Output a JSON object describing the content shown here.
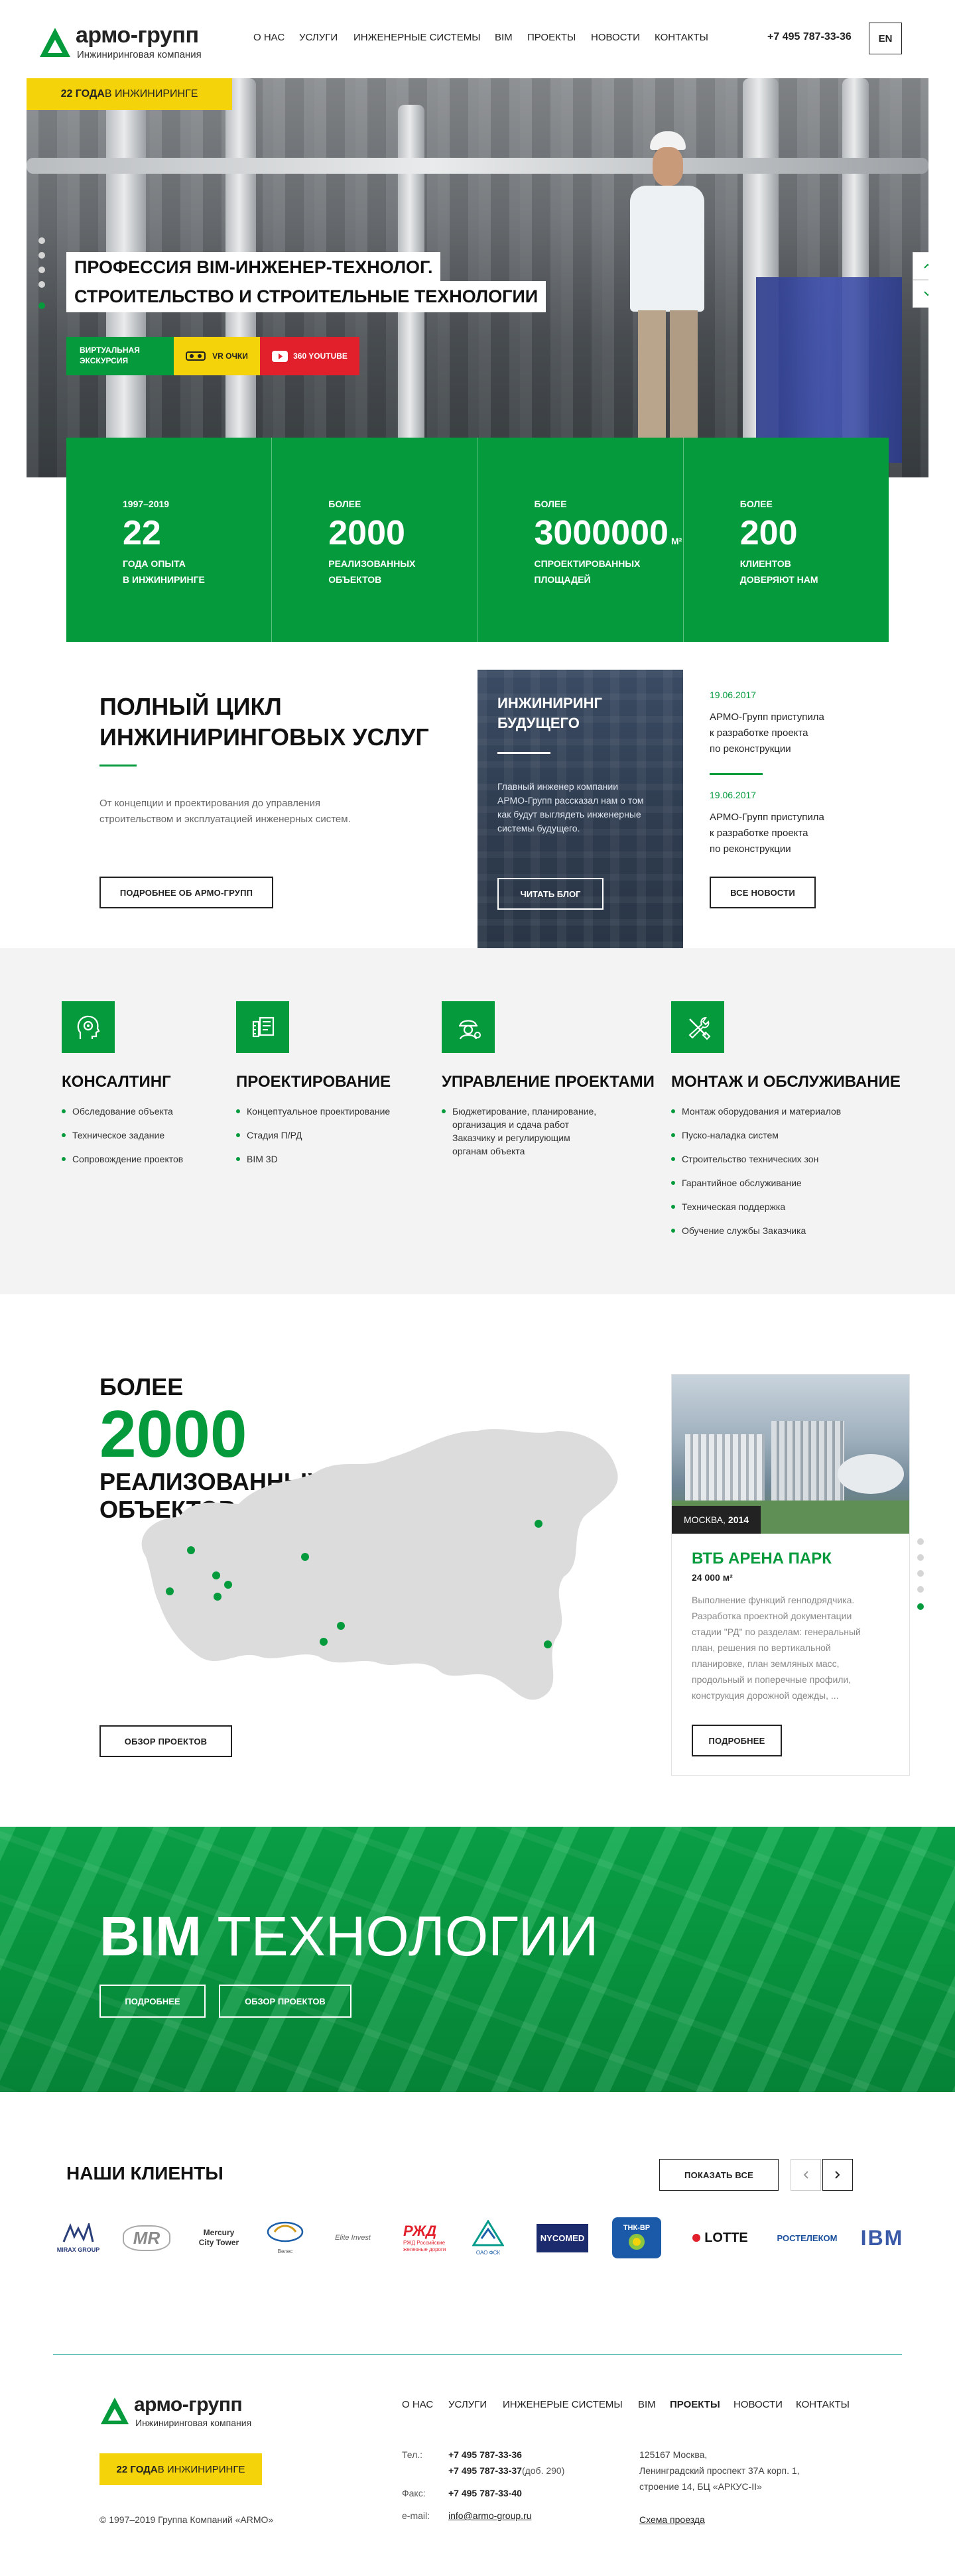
{
  "header": {
    "logo_name": "армо-групп",
    "logo_sub": "Инжиниринговая компания",
    "nav": [
      "О НАС",
      "УСЛУГИ",
      "ИНЖЕНЕРНЫЕ СИСТЕМЫ",
      "BIM",
      "ПРОЕКТЫ",
      "НОВОСТИ",
      "КОНТАКТЫ"
    ],
    "phone": "+7 495 787-33-36",
    "lang": "EN"
  },
  "hero": {
    "badge_bold": "22 ГОДА",
    "badge_rest": " В ИНЖИНИРИНГЕ",
    "title_line1": "ПРОФЕССИЯ BIM-ИНЖЕНЕР-ТЕХНОЛОГ.",
    "title_line2": "СТРОИТЕЛЬСТВО И СТРОИТЕЛЬНЫЕ ТЕХНОЛОГИИ",
    "btn_tour": "ВИРТУАЛЬНАЯ ЭКСКУРСИЯ",
    "btn_vr": "VR ОЧКИ",
    "btn_youtube": "360 YOUTUBE"
  },
  "stats": [
    {
      "label": "1997–2019",
      "value": "22",
      "unit": "",
      "caption1": "ГОДА ОПЫТА",
      "caption2": "В ИНЖИНИРИНГЕ"
    },
    {
      "label": "БОЛЕЕ",
      "value": "2000",
      "unit": "",
      "caption1": "РЕАЛИЗОВАННЫХ",
      "caption2": "ОБЪЕКТОВ"
    },
    {
      "label": "БОЛЕЕ",
      "value": "3000000",
      "unit": "М²",
      "caption1": "СПРОЕКТИРОВАННЫХ",
      "caption2": "ПЛОЩАДЕЙ"
    },
    {
      "label": "БОЛЕЕ",
      "value": "200",
      "unit": "",
      "caption1": "КЛИЕНТОВ",
      "caption2": "ДОВЕРЯЮТ НАМ"
    }
  ],
  "about": {
    "title_line1": "ПОЛНЫЙ ЦИКЛ",
    "title_line2": "ИНЖИНИРИНГОВЫХ УСЛУГ",
    "text_line1": "От концепции и проектирования до управления",
    "text_line2": "строительством и эксплуатацией инженерных систем.",
    "button": "ПОДРОБНЕЕ ОБ АРМО-ГРУПП"
  },
  "blog": {
    "title_line1": "ИНЖИНИРИНГ",
    "title_line2": "БУДУЩЕГО",
    "text_line1": "Главный инженер компании",
    "text_line2": "АРМО-Групп рассказал нам о том",
    "text_line3": "как будут выглядеть инженерные",
    "text_line4": "системы будущего.",
    "button": "ЧИТАТЬ БЛОГ"
  },
  "news": {
    "items": [
      {
        "date": "19.06.2017",
        "line1": "АРМО-Групп приступила",
        "line2": "к разработке проекта",
        "line3": "по реконструкции"
      },
      {
        "date": "19.06.2017",
        "line1": "АРМО-Групп приступила",
        "line2": "к разработке проекта",
        "line3": "по реконструкции"
      }
    ],
    "button": "ВСЕ НОВОСТИ"
  },
  "services": [
    {
      "title": "КОНСАЛТИНГ",
      "icon": "head-gear-icon",
      "items": [
        "Обследование объекта",
        "Техническое задание",
        "Сопровождение проектов"
      ]
    },
    {
      "title": "ПРОЕКТИРОВАНИЕ",
      "icon": "blueprint-icon",
      "items": [
        "Концептуальное проектирование",
        "Стадия П/РД",
        "BIM 3D"
      ]
    },
    {
      "title": "УПРАВЛЕНИЕ ПРОЕКТАМИ",
      "icon": "engineer-icon",
      "items_multi": [
        "Бюджетирование, планирование,",
        "организация и сдача работ",
        "Заказчику и регулирующим",
        "органам объекта"
      ]
    },
    {
      "title": "МОНТАЖ И ОБСЛУЖИВАНИЕ",
      "icon": "tools-icon",
      "items": [
        "Монтаж оборудования и материалов",
        "Пуско-наладка систем",
        "Строительство технических зон",
        "Гарантийное обслуживание",
        "Техническая поддержка",
        "Обучение службы Заказчика"
      ]
    }
  ],
  "projects": {
    "label_top": "БОЛЕЕ",
    "number": "2000",
    "label_bottom1": "РЕАЛИЗОВАННЫХ",
    "label_bottom2": "ОБЪЕКТОВ",
    "button": "ОБЗОР ПРОЕКТОВ",
    "card": {
      "city": "МОСКВА,",
      "year": "2014",
      "title": "ВТБ АРЕНА ПАРК",
      "area": "24 000 м²",
      "desc": [
        "Выполнение функций генподрядчика.",
        "Разработка проектной документации",
        "стадии \"РД\" по разделам: генеральный",
        "план, решения по вертикальной",
        "планировке, план земляных масс,",
        "продольный и поперечные профили,",
        "конструкция дорожной одежды, ..."
      ],
      "button": "ПОДРОБНЕЕ"
    }
  },
  "bim": {
    "title_bold": "BIM",
    "title_light": " ТЕХНОЛОГИИ",
    "btn_more": "ПОДРОБНЕЕ",
    "btn_projects": "ОБЗОР ПРОЕКТОВ"
  },
  "clients": {
    "title": "НАШИ КЛИЕНТЫ",
    "button": "ПОКАЗАТЬ ВСЕ",
    "logos": [
      "MIRAX GROUP",
      "MR",
      "Mercury City Tower",
      "Велес",
      "Elite Invest",
      "РЖД Российские железные дороги",
      "ОАО ФСК",
      "NYCOMED",
      "ТНК-BP",
      "LOTTE",
      "РОСТЕЛЕКОМ",
      "IBM"
    ]
  },
  "footer": {
    "logo_name": "армо-групп",
    "logo_sub": "Инжиниринговая компания",
    "badge_bold": "22 ГОДА",
    "badge_rest": " В ИНЖИНИРИНГЕ",
    "copyright": "© 1997–2019 Группа Компаний «ARMO»",
    "nav": [
      "О НАС",
      "УСЛУГИ",
      "ИНЖЕНЕРЫЕ СИСТЕМЫ",
      "BIM",
      "ПРОЕКТЫ",
      "НОВОСТИ",
      "КОНТАКТЫ"
    ],
    "tel_label": "Тел.:",
    "tel1": "+7 495 787-33-36",
    "tel2": "+7 495 787-33-37",
    "tel2_ext": " (доб. 290)",
    "fax_label": "Факс:",
    "fax": "+7 495 787-33-40",
    "email_label": "e-mail:",
    "email": "info@armo-group.ru",
    "address1": "125167 Москва,",
    "address2": "Ленинградский проспект 37А корп. 1,",
    "address3": "строение 14, БЦ «АРКУС-II»",
    "map_link": "Схема проезда"
  },
  "colors": {
    "brand_green": "#059b3d",
    "yellow": "#f5d30b",
    "red": "#e2202c",
    "dark_card": "#2e3b4e"
  }
}
